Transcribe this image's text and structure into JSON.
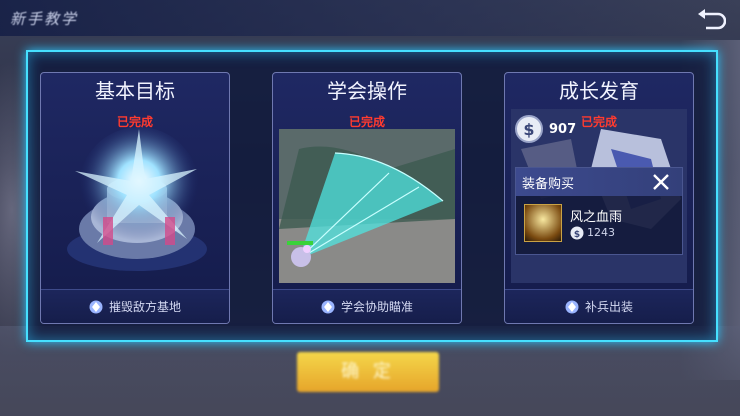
{
  "header": {
    "title": "新手教学",
    "return_icon": "return-arrow-icon"
  },
  "cards": [
    {
      "title": "基本目标",
      "status": "已完成",
      "footer_icon": "gem-icon",
      "footer_label": "摧毁敌方基地"
    },
    {
      "title": "学会操作",
      "status": "已完成",
      "footer_icon": "gem-icon",
      "footer_label": "学会协助瞄准"
    },
    {
      "title": "成长发育",
      "status": "已完成",
      "footer_icon": "gem-icon",
      "footer_label": "补兵出装",
      "gold": "907",
      "shop": {
        "title": "装备购买",
        "item_name": "风之血雨",
        "item_price": "1243"
      }
    }
  ],
  "confirm_label": "确 定",
  "colors": {
    "frame_glow": "#46e0ff",
    "status_red": "#ff3b2f",
    "confirm_yellow": "#f4d64a"
  }
}
